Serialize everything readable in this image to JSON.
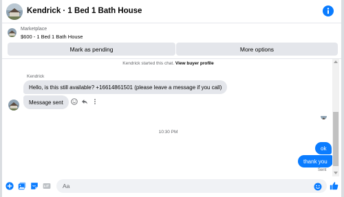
{
  "header": {
    "title": "Kendrick · 1 Bed 1 Bath House",
    "info_icon": "info-icon",
    "accent": "#0a7cff"
  },
  "listing": {
    "marketplace_label": "Marketplace",
    "price_title": "$600 - 1 Bed 1 Bath House",
    "mark_pending_label": "Mark as pending",
    "more_options_label": "More options"
  },
  "chat": {
    "system_text": "Kendrick started this chat.",
    "system_link": "View buyer profile",
    "sender_name": "Kendrick",
    "incoming": [
      "Hello, is this still available? +16614861501 (please leave a message if you call)",
      "Message sent"
    ],
    "timestamp": "10:30 PM",
    "outgoing": [
      "ok",
      "thank you"
    ],
    "status": "Sent",
    "reaction_icons": [
      "smile-reaction-icon",
      "reply-icon",
      "more-dots-icon"
    ]
  },
  "composer": {
    "placeholder": "Aa",
    "icons": [
      "plus-icon",
      "photo-icon",
      "sticker-icon",
      "gif-icon",
      "emoji-icon",
      "thumbs-up-icon"
    ]
  }
}
